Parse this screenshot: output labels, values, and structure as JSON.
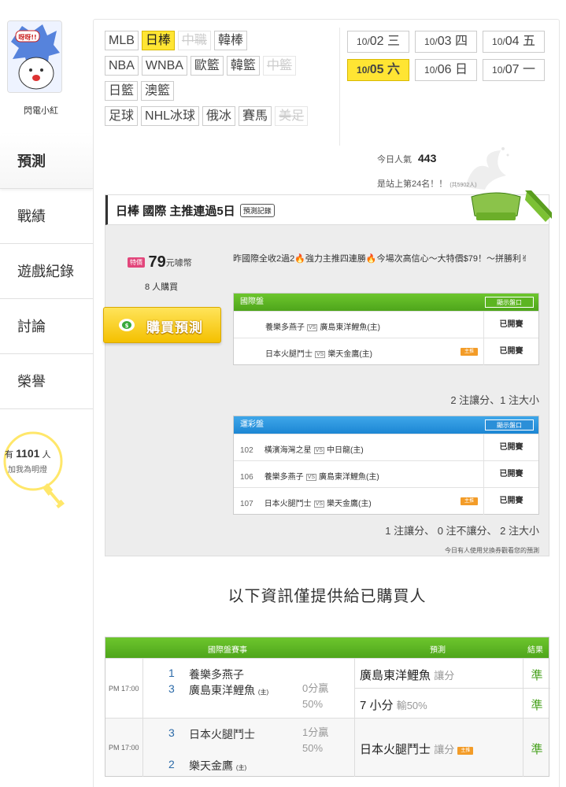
{
  "user": {
    "name": "閃電小紅"
  },
  "sidebar": {
    "items": [
      {
        "label": "預測",
        "active": true
      },
      {
        "label": "戰績"
      },
      {
        "label": "遊戲紀錄"
      },
      {
        "label": "討論"
      },
      {
        "label": "榮譽"
      }
    ],
    "fans_prefix": "有",
    "fans_count": "1101",
    "fans_suffix": "人",
    "fans_cta": "加我為明燈"
  },
  "leagues": {
    "row1": [
      "MLB",
      "日棒",
      "中職",
      "韓棒"
    ],
    "row2": [
      "NBA",
      "WNBA",
      "歐籃",
      "韓籃",
      "中籃"
    ],
    "row3": [
      "日籃",
      "澳籃"
    ],
    "row4": [
      "足球",
      "NHL冰球",
      "俄冰",
      "賽馬",
      "美足"
    ]
  },
  "dates": [
    {
      "md": "10/",
      "d": "02",
      "w": "三"
    },
    {
      "md": "10/",
      "d": "03",
      "w": "四"
    },
    {
      "md": "10/",
      "d": "04",
      "w": "五"
    },
    {
      "md": "10/",
      "d": "05",
      "w": "六"
    },
    {
      "md": "10/",
      "d": "06",
      "w": "日"
    },
    {
      "md": "10/",
      "d": "07",
      "w": "一"
    }
  ],
  "stats": {
    "popularity_label": "今日人氣",
    "popularity_value": "443",
    "rank_text": "是站上第24名！！",
    "rank_small": "(共5902人)"
  },
  "prediction": {
    "title": "日棒 國際 主推連過5日",
    "log_button": "預測記錄",
    "hot_tag": "特價",
    "price": "79",
    "price_unit": "元噱幣",
    "buyers": "8 人購買",
    "buy_button": "購買預測",
    "description": "昨國際全收2過2🔥強力主推四連勝🔥今場次高信心～大特價$79！～拼勝利✌",
    "intl": {
      "header": "國際盤",
      "show_btn": "顯示盤口",
      "rows": [
        {
          "away": "養樂多燕子",
          "home": "廣島東洋鯉魚(主)",
          "status": "已開賽",
          "tag": ""
        },
        {
          "away": "日本火腿鬥士",
          "home": "樂天金鷹(主)",
          "status": "已開賽",
          "tag": "主推"
        }
      ],
      "summary": "2 注讓分、1 注大小"
    },
    "lottery": {
      "header": "運彩盤",
      "show_btn": "顯示盤口",
      "rows": [
        {
          "num": "102",
          "away": "橫濱海灣之星",
          "home": "中日龍(主)",
          "status": "已開賽",
          "tag": ""
        },
        {
          "num": "106",
          "away": "養樂多燕子",
          "home": "廣島東洋鯉魚(主)",
          "status": "已開賽",
          "tag": ""
        },
        {
          "num": "107",
          "away": "日本火腿鬥士",
          "home": "樂天金鷹(主)",
          "status": "已開賽",
          "tag": "主推"
        }
      ],
      "summary": "1 注讓分、 0 注不讓分、 2 注大小"
    },
    "note": "今日有人使用兌換券觀看您的預測",
    "vs": "VS"
  },
  "info_title": "以下資訊僅提供給已購買人",
  "results": {
    "headers": {
      "match": "國際盤賽事",
      "pred": "預測",
      "result": "結果"
    },
    "rows": [
      {
        "time": "PM 17:00",
        "away_num": "1",
        "away": "養樂多燕子",
        "home_num": "3",
        "home": "廣島東洋鯉魚",
        "home_mark": "(主)",
        "handi1": "0分贏",
        "handi2": "50%",
        "pred1_main": "廣島東洋鯉魚",
        "pred1_sub": "讓分",
        "res1": "準",
        "pred2_main": "7 小分",
        "pred2_sub": "輸50%",
        "res2": "準"
      },
      {
        "time": "PM 17:00",
        "away_num": "3",
        "away": "日本火腿鬥士",
        "home_num": "2",
        "home": "樂天金鷹",
        "home_mark": "(主)",
        "handi1": "1分贏",
        "handi2": "50%",
        "pred1_main": "日本火腿鬥士",
        "pred1_sub": "讓分",
        "tag": "主推",
        "res1": "準"
      }
    ]
  },
  "colors": {
    "accent_yellow": "#ffe533",
    "green": "#4ea51b",
    "blue": "#1c86d4",
    "orange": "#f39c28",
    "result_green": "#46a11c"
  }
}
